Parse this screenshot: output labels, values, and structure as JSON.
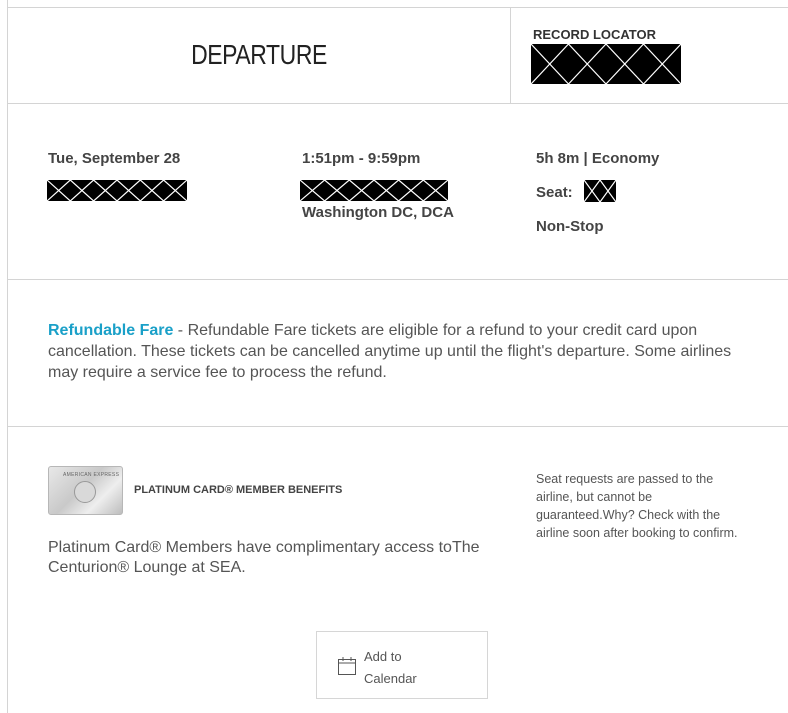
{
  "header": {
    "title": "DEPARTURE",
    "record_locator_label": "RECORD LOCATOR"
  },
  "flight": {
    "date": "Tue, September 28",
    "time": "1:51pm - 9:59pm",
    "destination": "Washington DC, DCA",
    "duration_class": "5h 8m | Economy",
    "seat_label": "Seat:",
    "stops": "Non-Stop"
  },
  "fare": {
    "name": "Refundable Fare",
    "description": " - Refundable Fare tickets are eligible for a refund to your credit card upon cancellation. These tickets can be cancelled anytime up until the flight's departure. Some airlines may require a service fee to process the refund.",
    "accent_color": "#1aa0c8"
  },
  "benefits": {
    "card_brand_text": "AMERICAN EXPRESS",
    "title": "PLATINUM CARD® MEMBER BENEFITS",
    "text": "Platinum Card® Members have complimentary access toThe Centurion® Lounge at SEA.",
    "seat_note": "Seat requests are passed to the airline, but cannot be guaranteed.Why? Check with the airline soon after booking to confirm."
  },
  "calendar": {
    "label_line1": "Add to",
    "label_line2": "Calendar",
    "icon": "calendar-icon"
  }
}
